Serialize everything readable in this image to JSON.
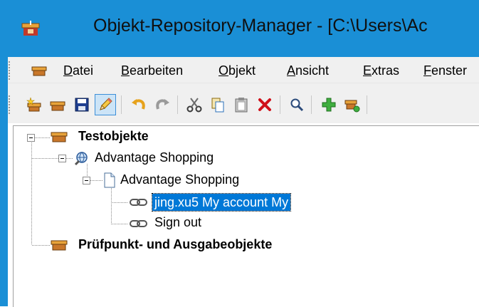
{
  "window": {
    "title": "Objekt-Repository-Manager - [C:\\Users\\Ac",
    "accent_color": "#1a8fd6"
  },
  "menu": {
    "items": [
      {
        "accel": "D",
        "rest": "atei"
      },
      {
        "accel": "B",
        "rest": "earbeiten"
      },
      {
        "accel": "O",
        "rest": "bjekt"
      },
      {
        "accel": "A",
        "rest": "nsicht"
      },
      {
        "accel": "E",
        "rest": "xtras"
      },
      {
        "accel": "F",
        "rest": "enster"
      }
    ]
  },
  "toolbar": {
    "buttons": [
      {
        "name": "new-repository",
        "icon": "new-star-box-icon"
      },
      {
        "name": "open-repository",
        "icon": "box-icon"
      },
      {
        "name": "save",
        "icon": "floppy-disk-icon"
      },
      {
        "name": "edit-mode",
        "icon": "pencil-icon",
        "pressed": true
      },
      {
        "name": "undo",
        "icon": "undo-arrow-icon"
      },
      {
        "name": "redo",
        "icon": "redo-arrow-icon"
      },
      {
        "name": "cut",
        "icon": "scissors-icon"
      },
      {
        "name": "copy",
        "icon": "copy-icon"
      },
      {
        "name": "paste",
        "icon": "clipboard-icon"
      },
      {
        "name": "delete",
        "icon": "red-x-icon"
      },
      {
        "name": "find",
        "icon": "magnifier-icon"
      },
      {
        "name": "add-object",
        "icon": "green-plus-icon"
      },
      {
        "name": "update-objects",
        "icon": "box-refresh-icon"
      }
    ]
  },
  "tree": {
    "root_test_objects": "Testobjekte",
    "browser": "Advantage Shopping",
    "page": "Advantage Shopping",
    "link_selected": "jing.xu5 My account My",
    "link_signout": "Sign out",
    "root_checkpoints": "Prüfpunkt- und Ausgabeobjekte",
    "selection_color": "#0078d7"
  }
}
